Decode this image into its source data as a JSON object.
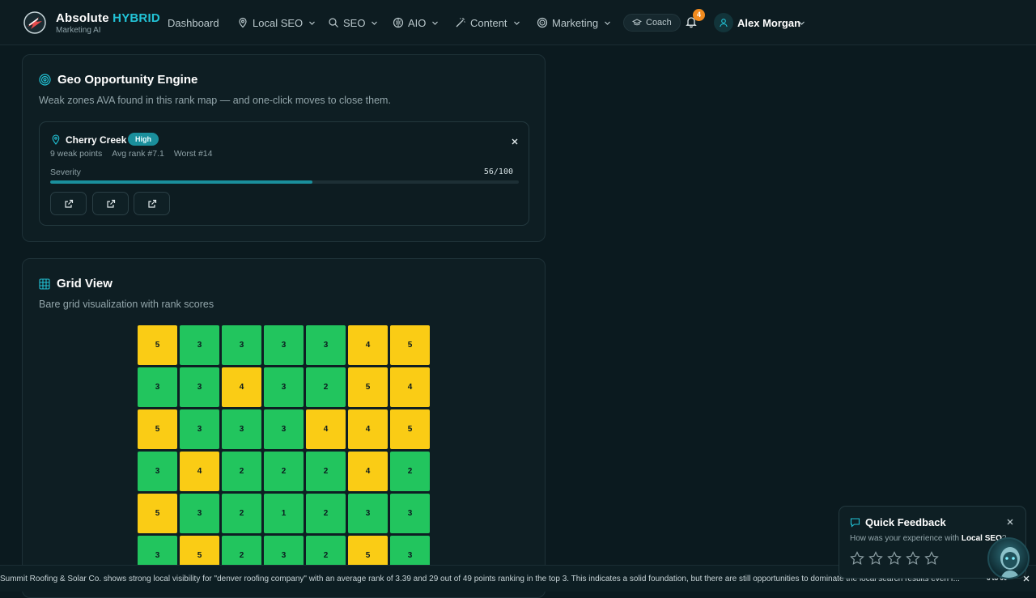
{
  "brand": {
    "name": "Absolute",
    "accent": "HYBRID",
    "subtitle": "Marketing AI"
  },
  "nav": [
    {
      "label": "Dashboard",
      "icon": ""
    },
    {
      "label": "Local SEO",
      "icon": "map-pin-icon"
    },
    {
      "label": "SEO",
      "icon": "search-icon"
    },
    {
      "label": "AIO",
      "icon": "brain-icon"
    },
    {
      "label": "Content",
      "icon": "wand-icon"
    },
    {
      "label": "Marketing",
      "icon": "target-icon"
    }
  ],
  "coach": {
    "label": "Coach"
  },
  "notifications": {
    "count": "4"
  },
  "user": {
    "name": "Alex Morgan"
  },
  "geo": {
    "title": "Geo Opportunity Engine",
    "subtitle": "Weak zones AVA found in this rank map — and one-click moves to close them.",
    "zone": {
      "name": "Cherry Creek",
      "priority": "High",
      "weak_points": "9 weak points",
      "avg_rank": "Avg rank #7.1",
      "worst": "Worst #14",
      "severity_label": "Severity",
      "severity_value": "56/100",
      "severity_fraction": 0.56
    }
  },
  "grid_view": {
    "title": "Grid View",
    "subtitle": "Bare grid visualization with rank scores",
    "rows": [
      [
        "5",
        "3",
        "3",
        "3",
        "3",
        "4",
        "5"
      ],
      [
        "3",
        "3",
        "4",
        "3",
        "2",
        "5",
        "4"
      ],
      [
        "5",
        "3",
        "3",
        "3",
        "4",
        "4",
        "5"
      ],
      [
        "3",
        "4",
        "2",
        "2",
        "2",
        "4",
        "2"
      ],
      [
        "5",
        "3",
        "2",
        "1",
        "2",
        "3",
        "3"
      ],
      [
        "3",
        "5",
        "2",
        "3",
        "2",
        "5",
        "3"
      ]
    ],
    "colors": {
      "good": "#22c55e",
      "mid": "#facc15"
    }
  },
  "ticker": {
    "text": "Summit Roofing & Solar Co. shows strong local visibility for \"denver roofing company\" with an average rank of 3.39 and 29 out of 49 points ranking in the top 3. This indicates a solid foundation, but there are still opportunities to dominate the local search results even f...",
    "time": "6 to 00"
  },
  "feedback": {
    "title": "Quick Feedback",
    "question": "How was your experience with",
    "topic": "Local SEO",
    "question_end": "?",
    "rating": 0,
    "max_rating": 5
  }
}
